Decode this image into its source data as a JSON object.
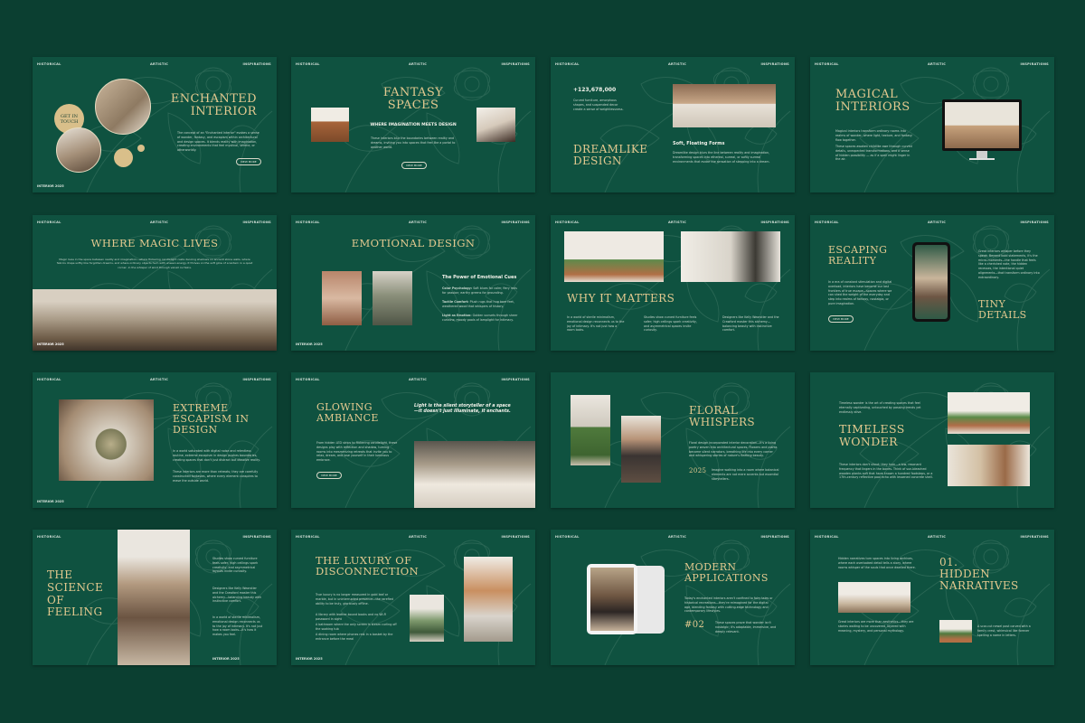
{
  "header": {
    "left": "HISTORICAL",
    "center": "ARTISTIC",
    "right": "INSPIRATIONS"
  },
  "footer_label": "INTERIOR 2025",
  "colors": {
    "background": "#0b3f31",
    "slide": "#0f5240",
    "accent": "#e3c98f",
    "gold_circle": "#d9bf8a"
  },
  "slides": [
    {
      "title": "ENCHANTED\nINTERIOR",
      "badge": "GET IN\nTOUCH",
      "body": "The concept of an \"Enchanted Interior\" evokes a sense of wonder, fantasy, and escapism within architectural and design spaces. It blends reality with imagination, creating environments that feel mystical, serene, or otherworldly.",
      "button": "VIEW MORE"
    },
    {
      "title": "FANTASY\nSPACES",
      "subtitle": "WHERE IMAGINATION MEETS DESIGN",
      "body": "These interiors blur the boundaries between reality and dreams, inviting you into spaces that feel like a portal to another world.",
      "button": "VIEW MORE"
    },
    {
      "stat": "+123,678,000",
      "stat_text": "Curved furniture, amorphous shapes, and suspended decor create a sense of weightlessness.",
      "title": "DREAMLIKE\nDESIGN",
      "subtitle": "Soft, Floating Forms",
      "body": "Dreamlike design blurs the line between reality and imagination, transforming spaces into ethereal, surreal, or softly surreal environments that evoke the sensation of stepping into a dream."
    },
    {
      "title": "MAGICAL\nINTERIORS",
      "body": "Magical interiors transform ordinary rooms into realms of wonder, where light, texture, and fantasy flow together.",
      "body2": "These spaces awaken childlike awe through curved details, unexpected transformations, and a sense of hidden possibility — as if a spell might linger in the air."
    },
    {
      "title": "WHERE MAGIC LIVES",
      "body": "Magic lives in the space between reality and imagination—where flickering candlelight casts dancing shadows on ancient stone walls, where fabrics drape softly like forgotten dreams, and where ordinary objects hum with unseen energy. It thrives on the soft glow of a lantern in a quiet corner, in the whisper of wind through velvet curtains."
    },
    {
      "title": "EMOTIONAL DESIGN",
      "subtitle": "The Power of Emotional Cues",
      "items": [
        {
          "label": "Color Psychology:",
          "text": "Soft blues for calm; fiery reds for passion; earthy greens for grounding."
        },
        {
          "label": "Tactile Comfort:",
          "text": "Plush rugs that hug bare feet, weathered wood that whispers of history."
        },
        {
          "label": "Light as Emotion:",
          "text": "Golden sunsets through sheer curtains; moody pools of lamplight for intimacy."
        }
      ]
    },
    {
      "title": "WHY IT MATTERS",
      "col1": "In a world of sterile minimalism, emotional design reconnects us to the joy of intimacy. It's not just how a room looks.",
      "col2": "Studies show curved furniture feels safer; high ceilings spark creativity, and asymmetrical spaces invite curiosity.",
      "col3": "Designers like Kelly Wearstler and the Crawford master this alchemy—balancing beauty with instinctive comfort."
    },
    {
      "title": "ESCAPING\nREALITY",
      "body": "In a era of constant stimulation and digital overload, interiors have become our last frontiers of true escape—spaces where we can shed the weight of the everyday and step into realms of fantasy, nostalgia, or pure imagination.",
      "button": "VIEW MORE",
      "right_body": "Great interiors whisper before they speak. Beyond bold statements, it's the micro-moments—the handle that feels like a cherished note, the hidden recesses, the intentional quiet alignments—that transform ordinary into extraordinary.",
      "title2": "TINY\nDETAILS"
    },
    {
      "title": "EXTREME\nESCAPISM IN\nDESIGN",
      "body": "In a world saturated with digital noise and relentless routine, extreme escapism in design pushes boundaries, creating spaces that don't just distract but dissolve reality.",
      "body2": "These interiors are more than retreats; they are carefully constructed fantasies, where every element conspires to erase the outside world."
    },
    {
      "title": "GLOWING\nAMBIANCE",
      "quote": "Light is the silent storyteller of a space—it doesn't just illuminate, it enchants.",
      "body": "From hidden LED strips to flickering candlelight, these designs play with reflection and shadow, turning rooms into mesmerizing retreats that invite you to relax, dream, and lose yourself in their luminous embrace.",
      "button": "VIEW MORE"
    },
    {
      "title": "FLORAL\nWHISPERS",
      "body": "Floral design incorporated interior decoration—It's a living poetry woven into architectural spaces. Flowers and plants become silent narrators, breathing life into every corner and whispering stories of nature's fleeting beauty.",
      "year": "2025",
      "year_text": "Imagine walking into a room where botanical elements are not mere accents but essential storytellers."
    },
    {
      "title": "TIMELESS\nWONDER",
      "body": "Timeless wonder is the art of creating spaces that feel eternally captivating, untouched by passing trends yet endlessly alive.",
      "body2": "These interiors don't shout; they hum—a low, resonant frequency that lingers in the bones. Think of sun-bleached wooden planks soft that have known a hundred footsteps, or a 17th-century reflective pool echo with lessened concrete shell."
    },
    {
      "title": "THE\nSCIENCE\nOF\nFEELING",
      "body": "Studies show curved furniture feels safer, high ceilings spark creativity, and asymmetrical layouts invite curiosity.",
      "body2": "Designers like Kelly Wearstler and the Crawford master this alchemy—balancing beauty with instinctive comfort.",
      "body3": "In a world of sterile minimalism, emotional design reconnects us to the joy of intimacy. It's not just how a room looks—it's how it makes you feel."
    },
    {
      "title": "THE LUXURY OF\nDISCONNECTION",
      "body": "True luxury is no longer measured in gold leaf or marble, but in uninterrupted presence—the rarefied ability to be truly, gloriously offline.",
      "bullets": [
        "A library with leather-bound books and no Wi-Fi password in sight",
        "A bathroom where the only screen is steam curling off the soaking tub",
        "A dining room where phones rest in a basket by the entrance before the meal"
      ]
    },
    {
      "title": "MODERN\nAPPLICATIONS",
      "body": "Today's enchanted interiors aren't confined to fairy tales or historical recreations—they're reimagined for the digital age, blending fantasy with cutting-edge technology and contemporary lifestyles.",
      "number": "#02",
      "number_text": "These spaces prove that wonder isn't nostalgic; it's adaptable, immersive, and deeply relevant."
    },
    {
      "title": "01.\nHIDDEN\nNARRATIVES",
      "body": "Hidden narratives turn spaces into living archives, where each overlooked detail tells a story, where rooms whisper of the souls that once dwelled there.",
      "body2": "Great interiors are more than aesthetics—they are stories waiting to be uncovered, layered with meaning, mystery, and personal mythology.",
      "body3": "A scar-cut newel post carved with a family crest, whimsical like forever spelling a name in letters."
    }
  ]
}
